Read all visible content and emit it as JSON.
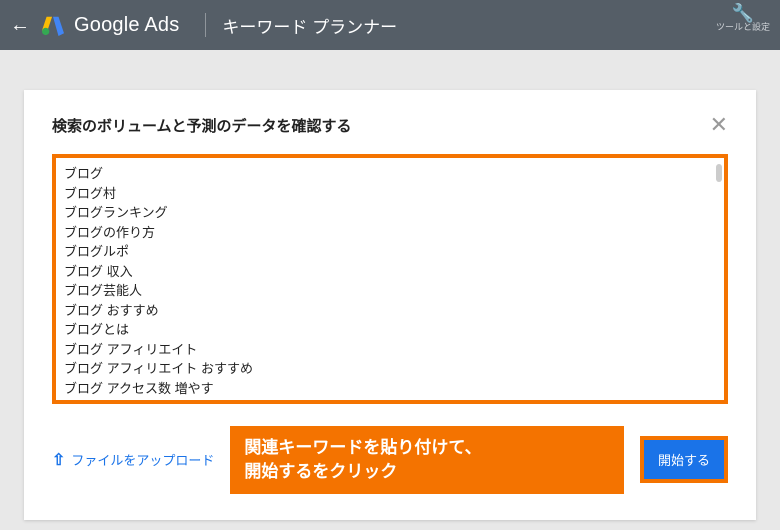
{
  "header": {
    "brand": "Google Ads",
    "page_title": "キーワード プランナー",
    "tools_label": "ツールと設定"
  },
  "card": {
    "title": "検索のボリュームと予測のデータを確認する",
    "keywords": [
      "ブログ",
      "ブログ村",
      "ブログランキング",
      "ブログの作り方",
      "ブログルポ",
      "ブログ 収入",
      "ブログ芸能人",
      "ブログ おすすめ",
      "ブログとは",
      "ブログ アフィリエイト",
      "ブログ アフィリエイト おすすめ",
      "ブログ アクセス数 増やす"
    ],
    "upload_label": "ファイルをアップロード",
    "start_label": "開始する"
  },
  "annotation": {
    "callout": "関連キーワードを貼り付けて、\n開始するをクリック"
  }
}
